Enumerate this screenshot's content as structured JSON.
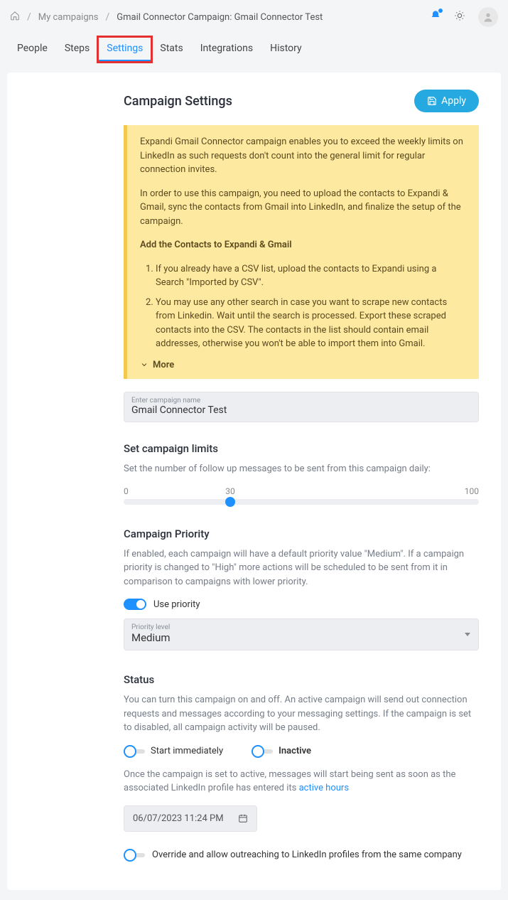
{
  "breadcrumb": {
    "root": "My campaigns",
    "current": "Gmail Connector Campaign: Gmail Connector Test"
  },
  "tabs": [
    "People",
    "Steps",
    "Settings",
    "Stats",
    "Integrations",
    "History"
  ],
  "activeTab": "Settings",
  "header": {
    "title": "Campaign Settings",
    "apply_label": "Apply"
  },
  "info": {
    "p1": "Expandi Gmail Connector campaign enables you to exceed the weekly limits on LinkedIn as such requests don't count into the general limit for regular connection invites.",
    "p2": "In order to use this campaign, you need to upload the contacts to Expandi & Gmail, sync the contacts from Gmail into LinkedIn, and finalize the setup of the campaign.",
    "heading": "Add the Contacts to Expandi & Gmail",
    "li1": "If you already have a CSV list, upload the contacts to Expandi using a Search \"Imported by CSV\".",
    "li2": "You may use any other search in case you want to scrape new contacts from Linkedin. Wait until the search is processed. Export these scraped contacts into the CSV. The contacts in the list should contain email addresses, otherwise you won't be able to import them into Gmail.",
    "more": "More"
  },
  "name_field": {
    "label": "Enter campaign name",
    "value": "Gmail Connector Test"
  },
  "limits": {
    "title": "Set campaign limits",
    "desc": "Set the number of follow up messages to be sent from this campaign daily:",
    "min": "0",
    "value": "30",
    "max": "100"
  },
  "priority": {
    "title": "Campaign Priority",
    "desc": "If enabled, each campaign will have a default priority value \"Medium\". If a campaign priority is changed to \"High\" more actions will be scheduled to be sent from it in comparison to campaigns with lower priority.",
    "toggle_label": "Use priority",
    "level_label": "Priority level",
    "level_value": "Medium"
  },
  "status": {
    "title": "Status",
    "desc": "You can turn this campaign on and off. An active campaign will send out connection requests and messages according to your messaging settings. If the campaign is set to disabled, all campaign activity will be paused.",
    "opt1": "Start immediately",
    "opt2": "Inactive",
    "note_pre": "Once the campaign is set to active, messages will start being sent as soon as the associated LinkedIn profile has entered its ",
    "note_link": "active hours",
    "date": "06/07/2023 11:24 PM",
    "override": "Override and allow outreaching to LinkedIn profiles from the same company"
  }
}
